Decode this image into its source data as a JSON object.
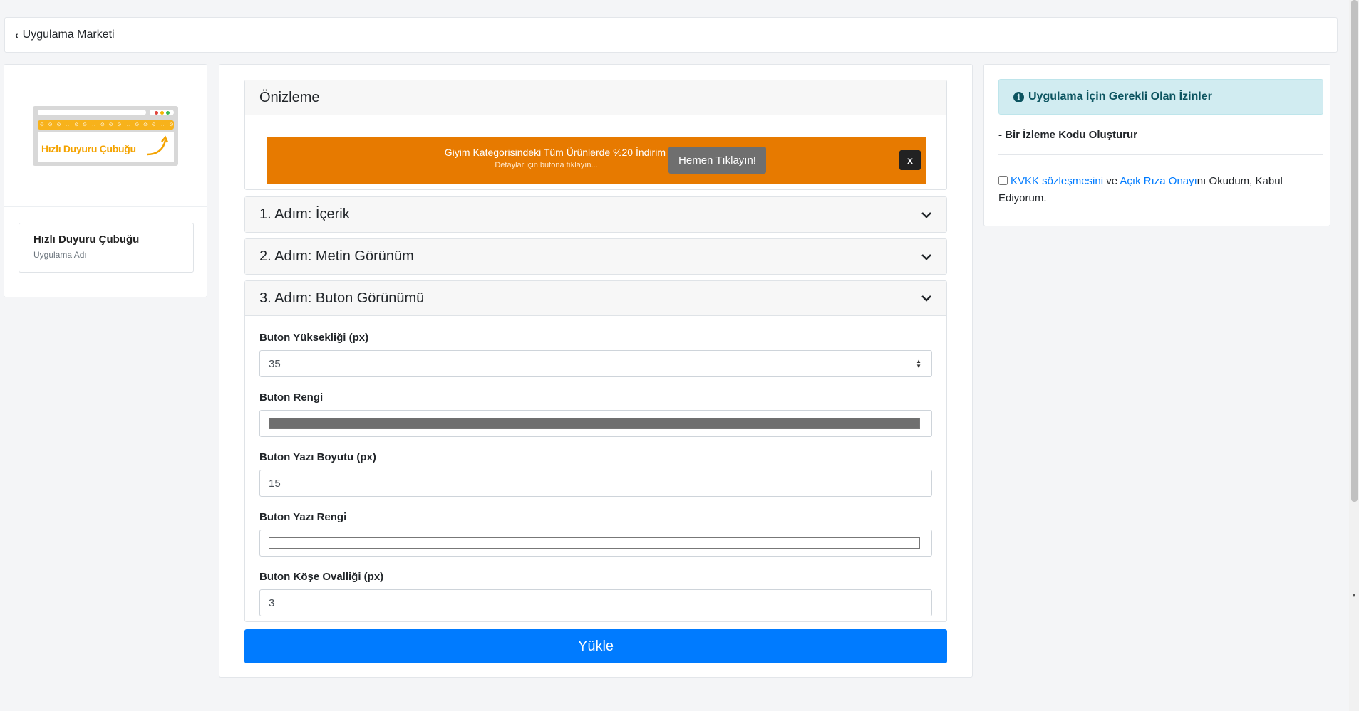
{
  "nav": {
    "back_label": "Uygulama Marketi"
  },
  "app_card": {
    "thumb_brand": "Hızlı Duyuru Çubuğu",
    "name": "Hızlı Duyuru Çubuğu",
    "name_caption": "Uygulama Adı"
  },
  "preview": {
    "title": "Önizleme",
    "bar_color": "#e77a00",
    "line1": "Giyim Kategorisindeki Tüm Ürünlerde %20 İndirim",
    "line2": "Detaylar için butona tıklayın...",
    "button_label": "Hemen Tıklayın!",
    "button_color": "#6f6f6f",
    "close_label": "x"
  },
  "steps": [
    {
      "title": "1. Adım: İçerik",
      "expanded": false
    },
    {
      "title": "2. Adım: Metin Görünüm",
      "expanded": false
    },
    {
      "title": "3. Adım: Buton Görünümü",
      "expanded": true
    }
  ],
  "button_form": {
    "height_label": "Buton Yüksekliği (px)",
    "height_value": "35",
    "color_label": "Buton Rengi",
    "color_value": "#6f6f6f",
    "font_size_label": "Buton Yazı Boyutu (px)",
    "font_size_value": "15",
    "text_color_label": "Buton Yazı Rengi",
    "text_color_value": "#ffffff",
    "radius_label": "Buton Köşe Ovalliği (px)",
    "radius_value": "3"
  },
  "submit_label": "Yükle",
  "permissions": {
    "title": "Uygulama İçin Gerekli Olan İzinler",
    "items": [
      "- Bir İzleme Kodu Oluşturur"
    ],
    "consent_link1": "KVKK sözleşmesini",
    "consent_mid": " ve ",
    "consent_link2": "Açık Rıza Onayı",
    "consent_tail": "nı Okudum, Kabul Ediyorum."
  }
}
